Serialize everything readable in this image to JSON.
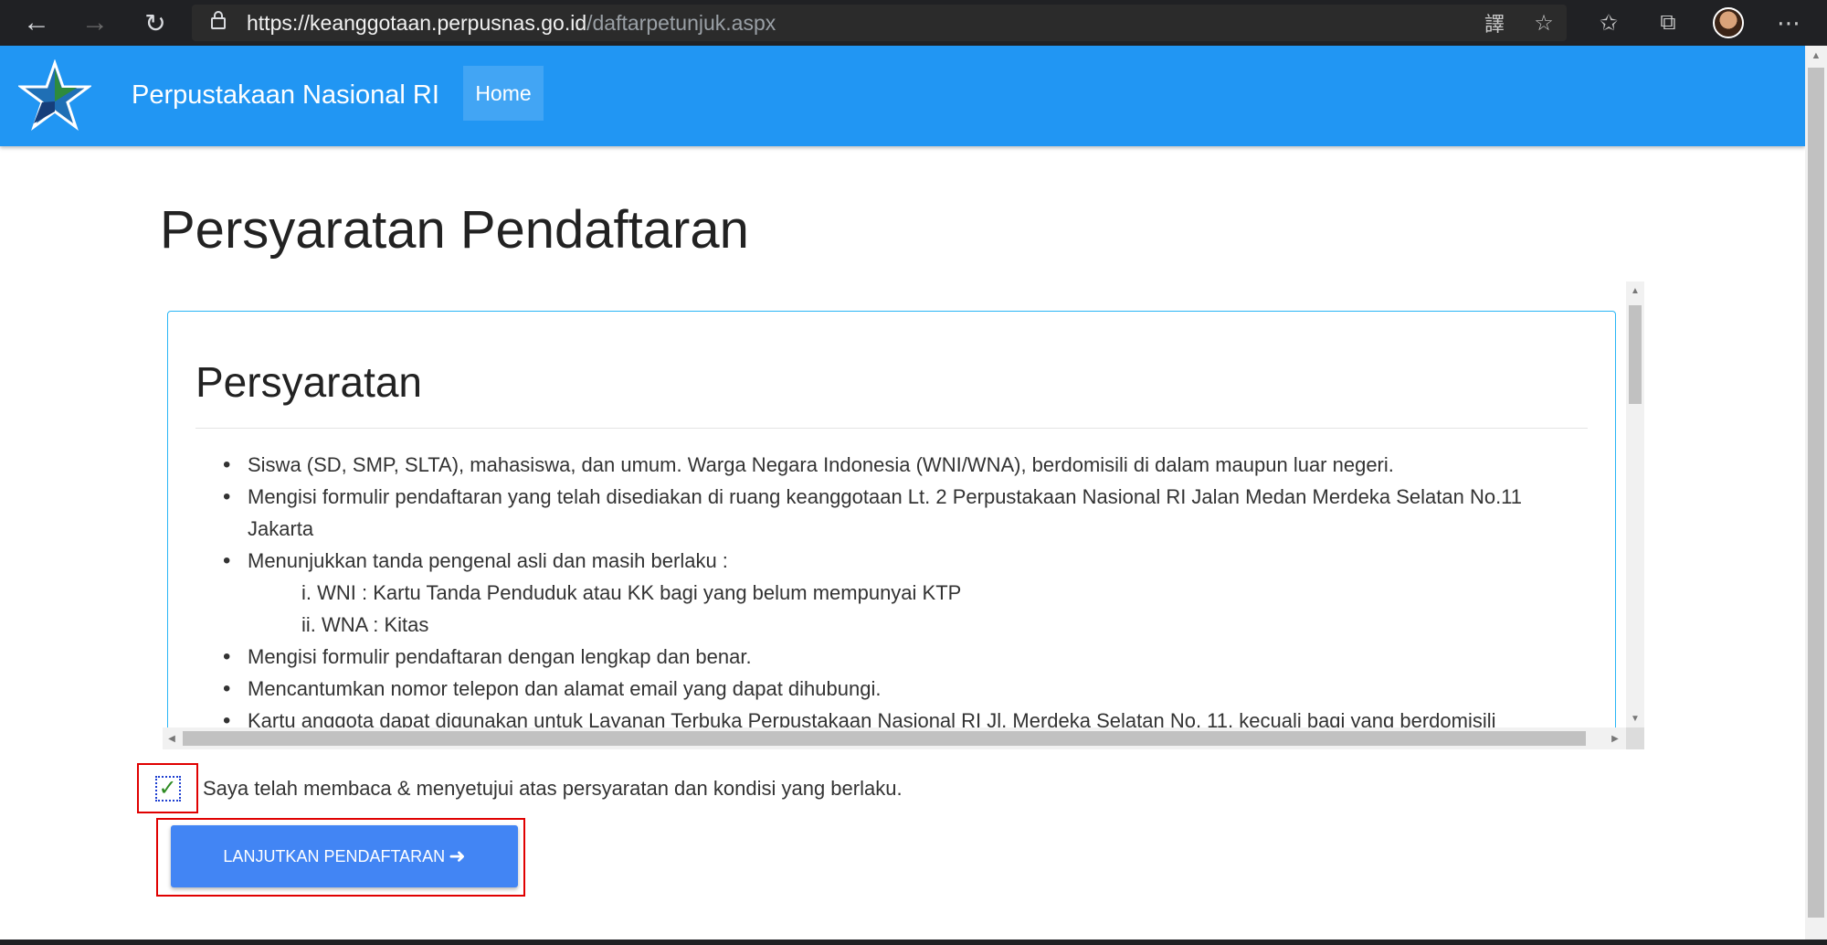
{
  "browser": {
    "url_domain": "https://keanggotaan.perpusnas.go.id",
    "url_path": "/daftarpetunjuk.aspx",
    "icons": [
      "back-icon",
      "forward-icon",
      "refresh-icon",
      "lock-icon",
      "translate-icon",
      "favorite-star-icon",
      "favorites-list-icon",
      "collections-icon",
      "profile-avatar",
      "more-icon"
    ]
  },
  "site": {
    "title": "Perpustakaan Nasional RI",
    "nav_home": "Home",
    "brand_color": "#2196f3"
  },
  "page": {
    "title": "Persyaratan Pendaftaran"
  },
  "requirements": {
    "heading": "Persyaratan",
    "items": [
      "Siswa (SD, SMP, SLTA), mahasiswa, dan umum. Warga Negara Indonesia (WNI/WNA), berdomisili di dalam maupun luar negeri.",
      "Mengisi formulir pendaftaran yang telah disediakan di ruang keanggotaan Lt. 2  Perpustakaan Nasional RI Jalan Medan Merdeka Selatan No.11 Jakarta",
      "Menunjukkan tanda pengenal asli dan masih berlaku :",
      "Mengisi formulir pendaftaran dengan lengkap dan benar.",
      "Mencantumkan nomor telepon dan alamat email yang dapat dihubungi.",
      "Kartu anggota dapat digunakan untuk Layanan Terbuka Perpustakaan Nasional RI Jl. Merdeka Selatan No. 11, kecuali bagi yang berdomisili"
    ],
    "sub_items": [
      "i. WNI : Kartu Tanda Penduduk atau KK bagi yang belum mempunyai KTP",
      "ii. WNA : Kitas"
    ]
  },
  "agreement": {
    "checked": true,
    "label": "Saya telah membaca & menyetujui atas persyaratan dan kondisi yang berlaku."
  },
  "actions": {
    "continue_label": "LANJUTKAN PENDAFTARAN",
    "continue_icon": "arrow-right-icon"
  },
  "colors": {
    "button": "#4285f4",
    "highlight_frame": "#e00000",
    "panel_border": "#29b6f6"
  }
}
